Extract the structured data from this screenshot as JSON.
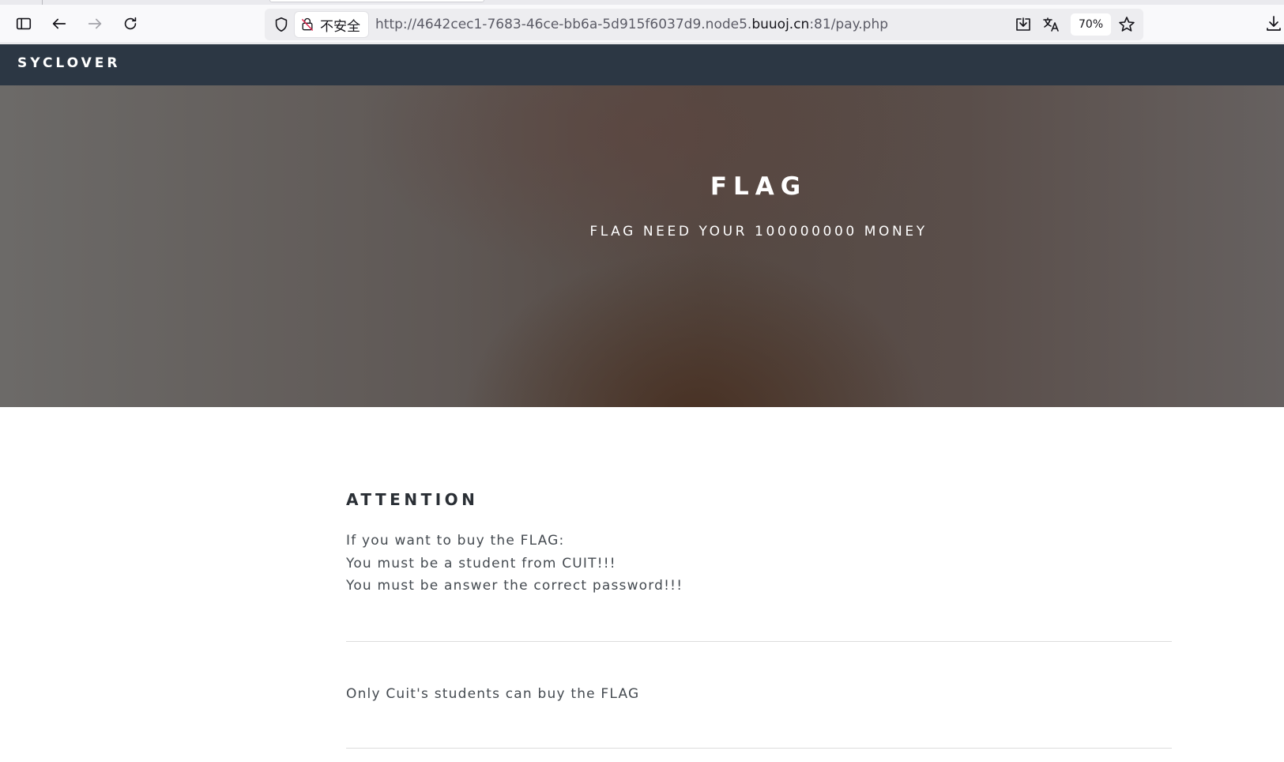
{
  "browser": {
    "security_label": "不安全",
    "url_prefix": "http://4642cec1-7683-46ce-bb6a-5d915f6037d9.node5.",
    "url_host": "buuoj.cn",
    "url_suffix": ":81/pay.php",
    "zoom": "70%",
    "icons": [
      "sidebar-icon",
      "back-icon",
      "forward-icon",
      "reload-icon",
      "shield-icon",
      "insecure-lock-icon",
      "save-page-icon",
      "translate-icon",
      "bookmark-star-icon",
      "download-icon"
    ]
  },
  "site": {
    "brand": "SYCLOVER",
    "colors": {
      "navbar": "#2c3744",
      "text": "#444a50",
      "heading": "#2a2f35"
    }
  },
  "hero": {
    "title": "FLAG",
    "subtitle": "FLAG NEED YOUR 100000000 MONEY"
  },
  "attention": {
    "heading": "ATTENTION",
    "lines": [
      "If you want to buy the FLAG:",
      "You must be a student from CUIT!!!",
      "You must be answer the correct password!!!"
    ]
  },
  "note": "Only Cuit's students can buy the FLAG"
}
